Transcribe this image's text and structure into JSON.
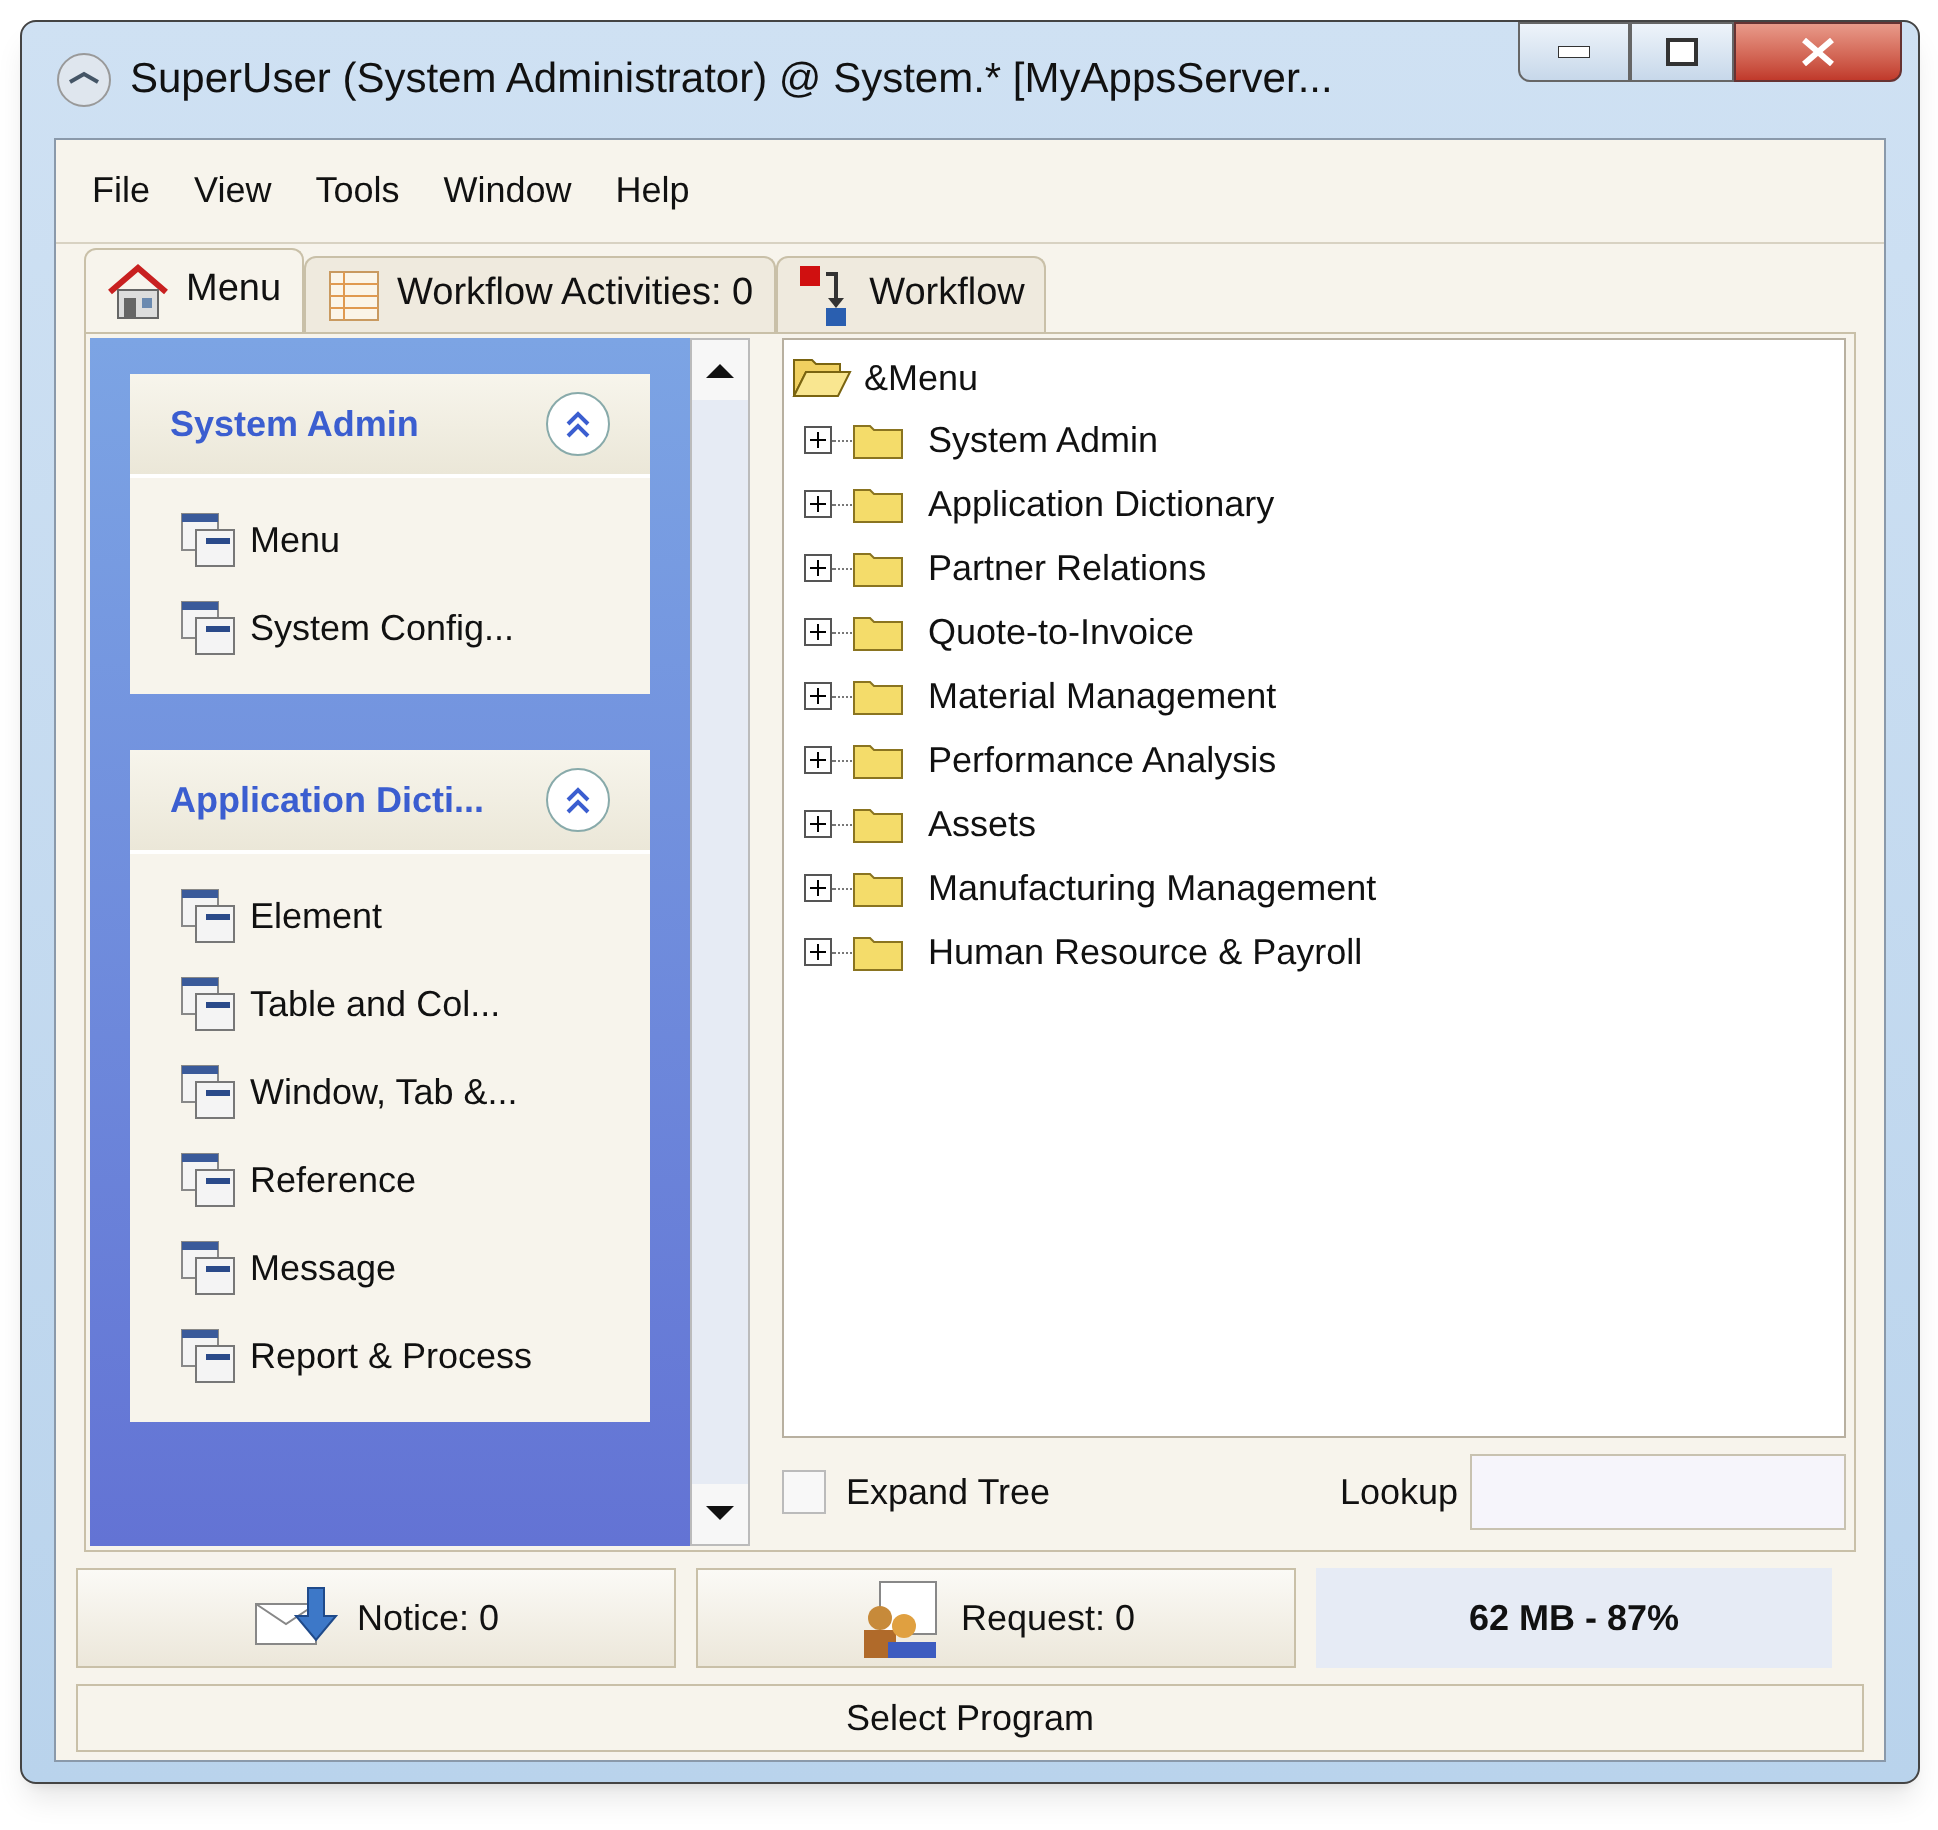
{
  "window": {
    "title": "SuperUser (System Administrator) @ System.* [MyAppsServer..."
  },
  "menu_bar": [
    "File",
    "View",
    "Tools",
    "Window",
    "Help"
  ],
  "tabs": [
    {
      "label": "Menu",
      "kind": "home",
      "selected": true
    },
    {
      "label": "Workflow Activities: 0",
      "kind": "table",
      "selected": false
    },
    {
      "label": "Workflow",
      "kind": "flow",
      "selected": false
    }
  ],
  "sidebar": {
    "groups": [
      {
        "title": "System Admin",
        "expanded": true,
        "items": [
          "Menu",
          "System Config..."
        ]
      },
      {
        "title": "Application Dicti...",
        "expanded": true,
        "items": [
          "Element",
          "Table and Col...",
          "Window, Tab &...",
          "Reference",
          "Message",
          "Report & Process"
        ]
      }
    ]
  },
  "tree": {
    "root": "&Menu",
    "children": [
      {
        "label": "System Admin",
        "expanded": false
      },
      {
        "label": "Application Dictionary",
        "expanded": false
      },
      {
        "label": "Partner Relations",
        "expanded": false
      },
      {
        "label": "Quote-to-Invoice",
        "expanded": false
      },
      {
        "label": "Material Management",
        "expanded": false
      },
      {
        "label": "Performance Analysis",
        "expanded": false
      },
      {
        "label": "Assets",
        "expanded": false
      },
      {
        "label": "Manufacturing Management",
        "expanded": false
      },
      {
        "label": "Human Resource & Payroll",
        "expanded": false
      }
    ]
  },
  "expand_tree": {
    "label": "Expand Tree",
    "checked": false
  },
  "lookup": {
    "label": "Lookup"
  },
  "notice_button": "Notice: 0",
  "request_button": "Request: 0",
  "memory": "62 MB - 87%",
  "status_bar": "Select Program"
}
